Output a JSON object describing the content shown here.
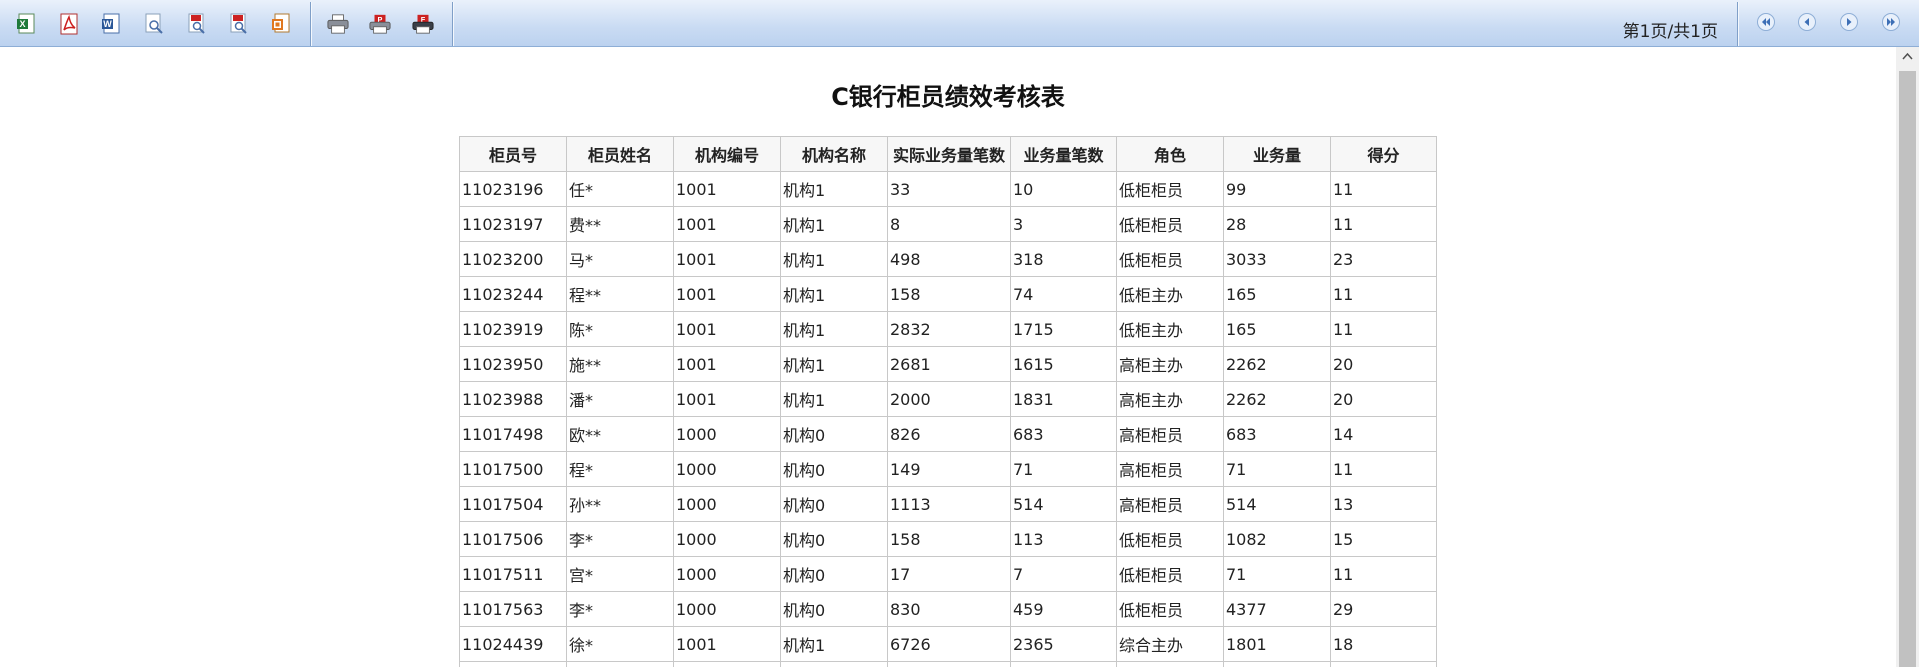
{
  "toolbar": {
    "export_icons": [
      "excel-export-icon",
      "pdf-export-icon",
      "word-export-icon",
      "preview-icon",
      "pdf-preview-icon",
      "pdf-preview-alt-icon",
      "html-export-icon"
    ],
    "print_icons": [
      "print-icon",
      "print-pdf-icon",
      "print-flash-icon"
    ],
    "page_info": "第1页/共1页",
    "nav_icons": [
      "first-page-icon",
      "prev-page-icon",
      "next-page-icon",
      "last-page-icon"
    ]
  },
  "report": {
    "title": "C银行柜员绩效考核表",
    "columns": [
      "柜员号",
      "柜员姓名",
      "机构编号",
      "机构名称",
      "实际业务量笔数",
      "业务量笔数",
      "角色",
      "业务量",
      "得分"
    ],
    "rows": [
      [
        "11023196",
        "任*",
        "1001",
        "机构1",
        "33",
        "10",
        "低柜柜员",
        "99",
        "11"
      ],
      [
        "11023197",
        "费**",
        "1001",
        "机构1",
        "8",
        "3",
        "低柜柜员",
        "28",
        "11"
      ],
      [
        "11023200",
        "马*",
        "1001",
        "机构1",
        "498",
        "318",
        "低柜柜员",
        "3033",
        "23"
      ],
      [
        "11023244",
        "程**",
        "1001",
        "机构1",
        "158",
        "74",
        "低柜主办",
        "165",
        "11"
      ],
      [
        "11023919",
        "陈*",
        "1001",
        "机构1",
        "2832",
        "1715",
        "低柜主办",
        "165",
        "11"
      ],
      [
        "11023950",
        "施**",
        "1001",
        "机构1",
        "2681",
        "1615",
        "高柜主办",
        "2262",
        "20"
      ],
      [
        "11023988",
        "潘*",
        "1001",
        "机构1",
        "2000",
        "1831",
        "高柜主办",
        "2262",
        "20"
      ],
      [
        "11017498",
        "欧**",
        "1000",
        "机构0",
        "826",
        "683",
        "高柜柜员",
        "683",
        "14"
      ],
      [
        "11017500",
        "程*",
        "1000",
        "机构0",
        "149",
        "71",
        "高柜柜员",
        "71",
        "11"
      ],
      [
        "11017504",
        "孙**",
        "1000",
        "机构0",
        "1113",
        "514",
        "高柜柜员",
        "514",
        "13"
      ],
      [
        "11017506",
        "李*",
        "1000",
        "机构0",
        "158",
        "113",
        "低柜柜员",
        "1082",
        "15"
      ],
      [
        "11017511",
        "宫*",
        "1000",
        "机构0",
        "17",
        "7",
        "低柜柜员",
        "71",
        "11"
      ],
      [
        "11017563",
        "李*",
        "1000",
        "机构0",
        "830",
        "459",
        "低柜柜员",
        "4377",
        "29"
      ],
      [
        "11024439",
        "徐*",
        "1001",
        "机构1",
        "6726",
        "2365",
        "综合主办",
        "1801",
        "18"
      ],
      [
        "",
        "",
        "",
        "",
        "",
        "",
        "",
        "",
        ""
      ]
    ]
  }
}
